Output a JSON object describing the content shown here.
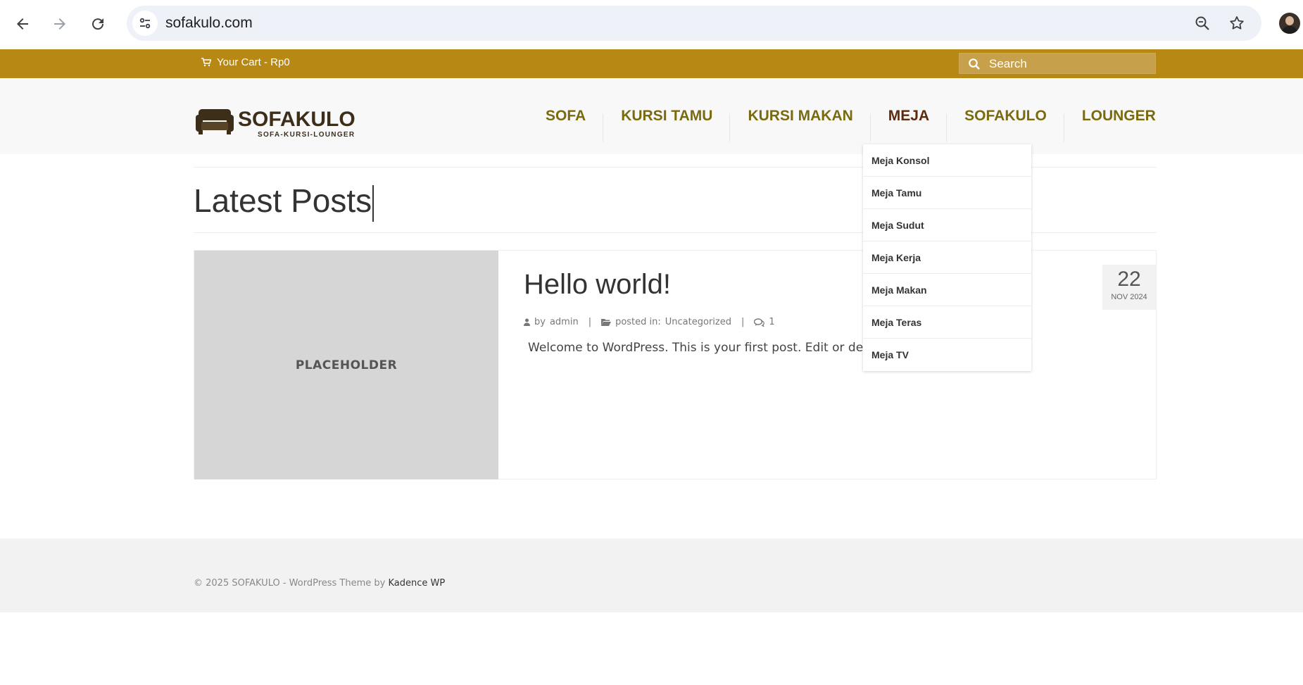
{
  "browser": {
    "url": "sofakulo.com",
    "icons": [
      "back-arrow-icon",
      "forward-arrow-icon",
      "reload-icon",
      "site-settings-icon",
      "zoom-icon",
      "bookmark-star-icon",
      "profile-avatar"
    ]
  },
  "topbar": {
    "cart_label": "Your Cart - Rp0",
    "search_placeholder": "Search",
    "background_color": "#b78813"
  },
  "header": {
    "logo_text": "SOFAKULO",
    "logo_tagline": "SOFA-KURSI-LOUNGER",
    "menu": [
      {
        "label": "SOFA"
      },
      {
        "label": "KURSI TAMU"
      },
      {
        "label": "KURSI MAKAN"
      },
      {
        "label": "MEJA"
      },
      {
        "label": "SOFAKULO"
      },
      {
        "label": "LOUNGER"
      }
    ],
    "active_menu": "MEJA",
    "menu_color": "#7a6a0f",
    "active_color": "#5c2a0c"
  },
  "dropdown": {
    "items": [
      "Meja Konsol",
      "Meja Tamu",
      "Meja Sudut",
      "Meja Kerja",
      "Meja Makan",
      "Meja Teras",
      "Meja TV"
    ]
  },
  "page": {
    "title": "Latest Posts"
  },
  "post": {
    "thumbnail_label": "PLACEHOLDER",
    "title": "Hello world!",
    "author_prefix": "by",
    "author": "admin",
    "category_prefix": "posted in:",
    "category": "Uncategorized",
    "comments": "1",
    "excerpt": "Welcome to WordPress. This is your first post. Edit or de",
    "date_day": "22",
    "date_month_year": "NOV 2024"
  },
  "footer": {
    "copyright": "© 2025 SOFAKULO - WordPress Theme by",
    "theme_link": "Kadence WP"
  }
}
